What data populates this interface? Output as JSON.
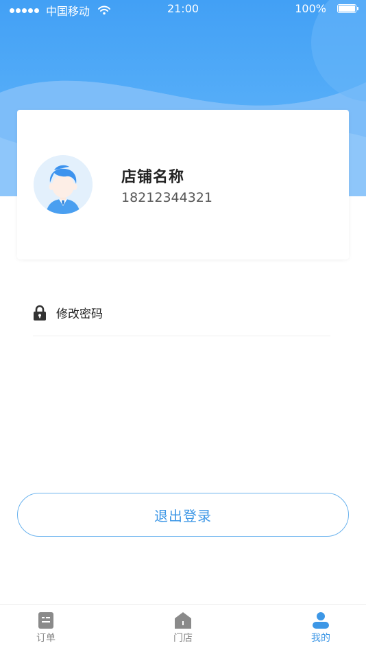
{
  "status_bar": {
    "carrier": "中国移动",
    "time": "21:00",
    "battery": "100%"
  },
  "profile": {
    "store_name": "店铺名称",
    "phone": "18212344321"
  },
  "menu": {
    "change_password": "修改密码"
  },
  "logout_label": "退出登录",
  "tabs": [
    {
      "label": "订单",
      "icon": "orders-icon",
      "active": false
    },
    {
      "label": "门店",
      "icon": "store-icon",
      "active": false
    },
    {
      "label": "我的",
      "icon": "user-icon",
      "active": true
    }
  ],
  "colors": {
    "accent": "#3d97e6",
    "header_blue": "#4aa3f6",
    "header_light": "#8fc6f9",
    "inactive_tab": "#888888"
  }
}
